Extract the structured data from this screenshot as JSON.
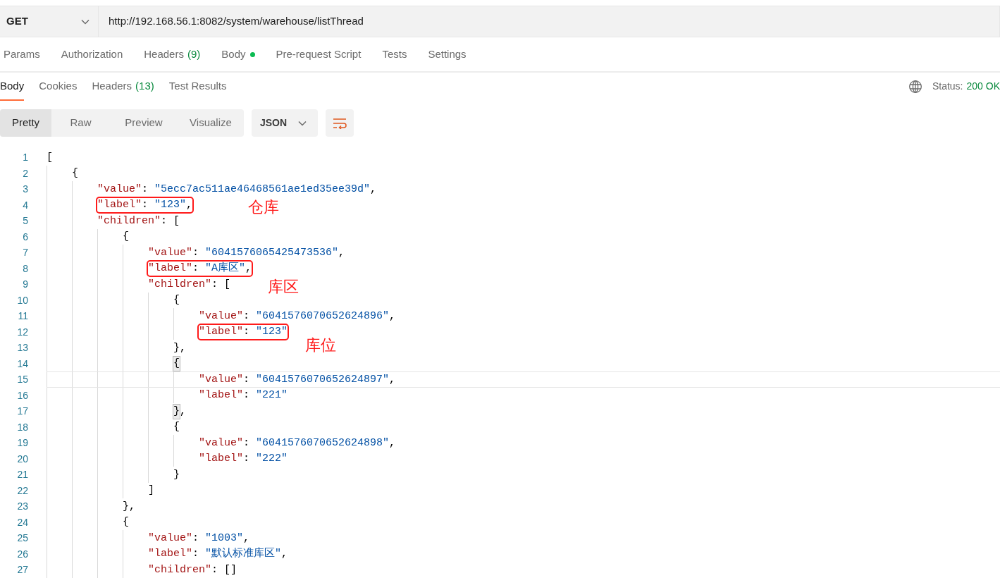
{
  "request": {
    "method": "GET",
    "url": "http://192.168.56.1:8082/system/warehouse/listThread"
  },
  "request_tabs": [
    {
      "label": "Params",
      "dot": false,
      "selected": false
    },
    {
      "label": "Authorization",
      "dot": false,
      "selected": false
    },
    {
      "label": "Headers",
      "count": "(9)",
      "dot": false,
      "selected": false
    },
    {
      "label": "Body",
      "dot": true,
      "selected": false
    },
    {
      "label": "Pre-request Script",
      "dot": false,
      "selected": false
    },
    {
      "label": "Tests",
      "dot": false,
      "selected": false
    },
    {
      "label": "Settings",
      "dot": false,
      "selected": false
    }
  ],
  "response_tabs": [
    {
      "label": "Body",
      "selected": true
    },
    {
      "label": "Cookies",
      "selected": false
    },
    {
      "label": "Headers",
      "count": "(13)",
      "selected": false
    },
    {
      "label": "Test Results",
      "selected": false
    }
  ],
  "status": {
    "label": "Status:",
    "value": "200 OK"
  },
  "view_modes": [
    {
      "label": "Pretty",
      "selected": true
    },
    {
      "label": "Raw",
      "selected": false
    },
    {
      "label": "Preview",
      "selected": false
    },
    {
      "label": "Visualize",
      "selected": false
    }
  ],
  "format": "JSON",
  "code_lines": [
    {
      "number": "1",
      "selected": false,
      "boxed": false,
      "tokens": [
        {
          "kind": "open",
          "text": "["
        }
      ]
    },
    {
      "number": "2",
      "selected": false,
      "boxed": false,
      "tokens": [
        {
          "kind": "open",
          "text": "{"
        }
      ]
    },
    {
      "number": "3",
      "selected": false,
      "boxed": false,
      "tokens": [
        {
          "kind": "key",
          "text": "\"value\""
        },
        {
          "kind": "punct",
          "text": ": "
        },
        {
          "kind": "string",
          "text": "\"5ecc7ac511ae46468561ae1ed35ee39d\""
        },
        {
          "kind": "punct",
          "text": ","
        }
      ]
    },
    {
      "number": "4",
      "selected": false,
      "boxed": true,
      "tokens": [
        {
          "kind": "key",
          "text": "\"label\""
        },
        {
          "kind": "punct",
          "text": ": "
        },
        {
          "kind": "string",
          "text": "\"123\""
        },
        {
          "kind": "punct",
          "text": ","
        }
      ]
    },
    {
      "number": "5",
      "selected": false,
      "boxed": false,
      "tokens": [
        {
          "kind": "key",
          "text": "\"children\""
        },
        {
          "kind": "punct",
          "text": ": "
        },
        {
          "kind": "open",
          "text": "["
        }
      ]
    },
    {
      "number": "6",
      "selected": false,
      "boxed": false,
      "tokens": [
        {
          "kind": "open",
          "text": "{"
        }
      ]
    },
    {
      "number": "7",
      "selected": false,
      "boxed": false,
      "tokens": [
        {
          "kind": "key",
          "text": "\"value\""
        },
        {
          "kind": "punct",
          "text": ": "
        },
        {
          "kind": "string",
          "text": "\"6041576065425473536\""
        },
        {
          "kind": "punct",
          "text": ","
        }
      ]
    },
    {
      "number": "8",
      "selected": false,
      "boxed": true,
      "tokens": [
        {
          "kind": "key",
          "text": "\"label\""
        },
        {
          "kind": "punct",
          "text": ": "
        },
        {
          "kind": "string",
          "text": "\"A库区\""
        },
        {
          "kind": "punct",
          "text": ","
        }
      ]
    },
    {
      "number": "9",
      "selected": false,
      "boxed": false,
      "tokens": [
        {
          "kind": "key",
          "text": "\"children\""
        },
        {
          "kind": "punct",
          "text": ": "
        },
        {
          "kind": "open",
          "text": "["
        }
      ]
    },
    {
      "number": "10",
      "selected": false,
      "boxed": false,
      "tokens": [
        {
          "kind": "open",
          "text": "{"
        }
      ]
    },
    {
      "number": "11",
      "selected": false,
      "boxed": false,
      "tokens": [
        {
          "kind": "key",
          "text": "\"value\""
        },
        {
          "kind": "punct",
          "text": ": "
        },
        {
          "kind": "string",
          "text": "\"6041576070652624896\""
        },
        {
          "kind": "punct",
          "text": ","
        }
      ]
    },
    {
      "number": "12",
      "selected": false,
      "boxed": true,
      "tokens": [
        {
          "kind": "key",
          "text": "\"label\""
        },
        {
          "kind": "punct",
          "text": ": "
        },
        {
          "kind": "string",
          "text": "\"123\""
        }
      ]
    },
    {
      "number": "13",
      "selected": false,
      "boxed": false,
      "tokens": [
        {
          "kind": "close",
          "text": "}"
        },
        {
          "kind": "punct",
          "text": ","
        }
      ]
    },
    {
      "number": "14",
      "selected": false,
      "boxed": false,
      "tokens": [
        {
          "kind": "open-matched",
          "text": "{"
        }
      ]
    },
    {
      "number": "15",
      "selected": true,
      "boxed": false,
      "tokens": [
        {
          "kind": "key",
          "text": "\"value\""
        },
        {
          "kind": "punct",
          "text": ": "
        },
        {
          "kind": "string",
          "text": "\"6041576070652624897\""
        },
        {
          "kind": "punct",
          "text": ","
        }
      ]
    },
    {
      "number": "16",
      "selected": false,
      "boxed": false,
      "tokens": [
        {
          "kind": "key",
          "text": "\"label\""
        },
        {
          "kind": "punct",
          "text": ": "
        },
        {
          "kind": "string",
          "text": "\"221\""
        }
      ]
    },
    {
      "number": "17",
      "selected": false,
      "boxed": false,
      "tokens": [
        {
          "kind": "close-matched",
          "text": "}"
        },
        {
          "kind": "punct",
          "text": ","
        }
      ]
    },
    {
      "number": "18",
      "selected": false,
      "boxed": false,
      "tokens": [
        {
          "kind": "open",
          "text": "{"
        }
      ]
    },
    {
      "number": "19",
      "selected": false,
      "boxed": false,
      "tokens": [
        {
          "kind": "key",
          "text": "\"value\""
        },
        {
          "kind": "punct",
          "text": ": "
        },
        {
          "kind": "string",
          "text": "\"6041576070652624898\""
        },
        {
          "kind": "punct",
          "text": ","
        }
      ]
    },
    {
      "number": "20",
      "selected": false,
      "boxed": false,
      "tokens": [
        {
          "kind": "key",
          "text": "\"label\""
        },
        {
          "kind": "punct",
          "text": ": "
        },
        {
          "kind": "string",
          "text": "\"222\""
        }
      ]
    },
    {
      "number": "21",
      "selected": false,
      "boxed": false,
      "tokens": [
        {
          "kind": "close",
          "text": "}"
        }
      ]
    },
    {
      "number": "22",
      "selected": false,
      "boxed": false,
      "tokens": [
        {
          "kind": "close",
          "text": "]"
        }
      ]
    },
    {
      "number": "23",
      "selected": false,
      "boxed": false,
      "tokens": [
        {
          "kind": "close",
          "text": "}"
        },
        {
          "kind": "punct",
          "text": ","
        }
      ]
    },
    {
      "number": "24",
      "selected": false,
      "boxed": false,
      "tokens": [
        {
          "kind": "open",
          "text": "{"
        }
      ]
    },
    {
      "number": "25",
      "selected": false,
      "boxed": false,
      "tokens": [
        {
          "kind": "key",
          "text": "\"value\""
        },
        {
          "kind": "punct",
          "text": ": "
        },
        {
          "kind": "string",
          "text": "\"1003\""
        },
        {
          "kind": "punct",
          "text": ","
        }
      ]
    },
    {
      "number": "26",
      "selected": false,
      "boxed": false,
      "tokens": [
        {
          "kind": "key",
          "text": "\"label\""
        },
        {
          "kind": "punct",
          "text": ": "
        },
        {
          "kind": "string",
          "text": "\"默认标准库区\""
        },
        {
          "kind": "punct",
          "text": ","
        }
      ]
    },
    {
      "number": "27",
      "selected": false,
      "boxed": false,
      "tokens": [
        {
          "kind": "key",
          "text": "\"children\""
        },
        {
          "kind": "punct",
          "text": ": "
        },
        {
          "kind": "open",
          "text": "["
        },
        {
          "kind": "close",
          "text": "]"
        }
      ]
    }
  ],
  "annotations": [
    "仓库",
    "库区",
    "库位"
  ]
}
